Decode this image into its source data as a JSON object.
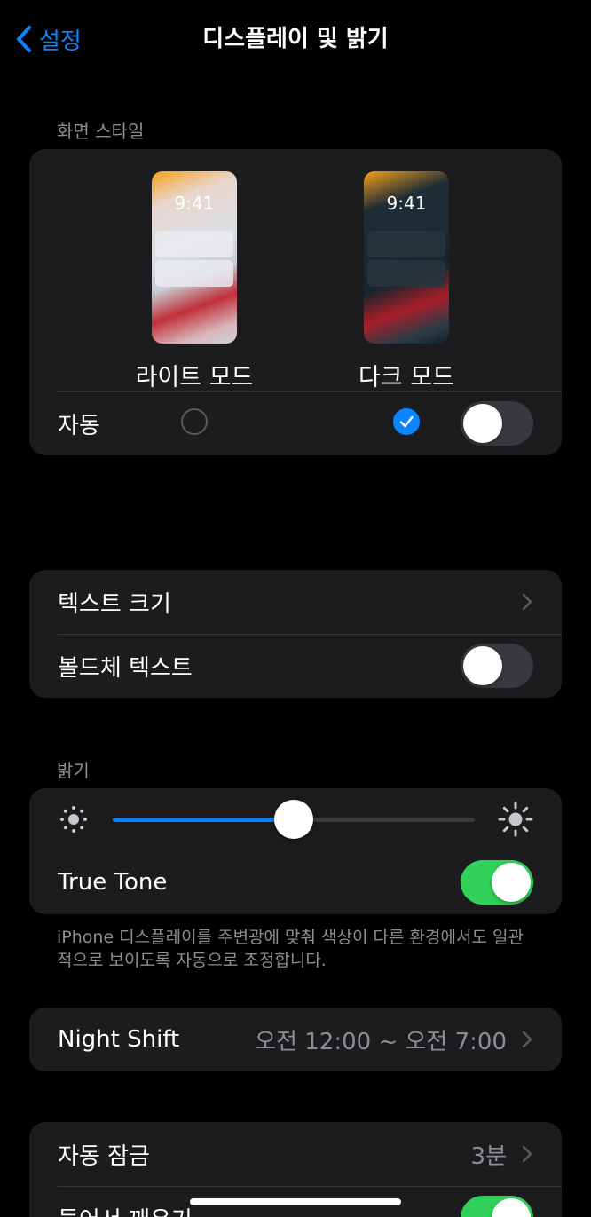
{
  "nav": {
    "back_label": "설정",
    "title": "디스플레이 및 밝기"
  },
  "appearance": {
    "header": "화면 스타일",
    "light": {
      "label": "라이트 모드",
      "time": "9:41",
      "selected": false
    },
    "dark": {
      "label": "다크 모드",
      "time": "9:41",
      "selected": true
    },
    "automatic": {
      "label": "자동",
      "on": false
    }
  },
  "text": {
    "text_size_label": "텍스트 크기",
    "bold_text_label": "볼드체 텍스트",
    "bold_text_on": false
  },
  "brightness": {
    "header": "밝기",
    "level_fraction": 0.5,
    "true_tone_label": "True Tone",
    "true_tone_on": true,
    "footnote": "iPhone 디스플레이를 주변광에 맞춰 색상이 다른 환경에서도 일관적으로 보이도록 자동으로 조정합니다."
  },
  "night_shift": {
    "label": "Night Shift",
    "value": "오전 12:00 ~ 오전 7:00"
  },
  "lock": {
    "auto_lock_label": "자동 잠금",
    "auto_lock_value": "3분",
    "raise_to_wake_label": "들어서 깨우기",
    "raise_to_wake_on": true
  },
  "colors": {
    "accent": "#0a84ff",
    "toggle_on": "#30d158",
    "group_bg": "#1c1c1e",
    "secondary_text": "#8d8d93"
  }
}
